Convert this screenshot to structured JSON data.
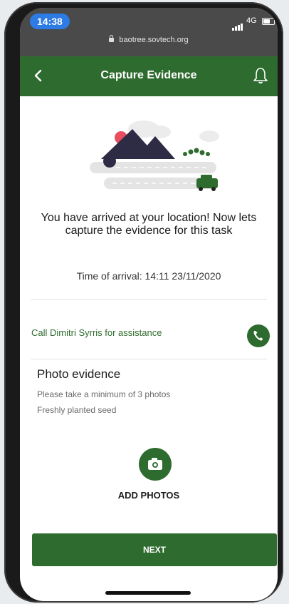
{
  "status_bar": {
    "time": "14:38",
    "network": "4G",
    "url": "baotree.sovtech.org",
    "icons": [
      "signal-icon",
      "battery-icon",
      "lock-icon"
    ]
  },
  "header": {
    "title": "Capture Evidence",
    "back_icon": "chevron-left-icon",
    "notification_icon": "bell-icon",
    "color": "#2e6b2e"
  },
  "main": {
    "illustration": "arrival-illustration",
    "headline": "You have arrived at your location! Now lets capture the evidence for this task",
    "arrival_label": "Time of arrival: 14:11 23/11/2020"
  },
  "assistance": {
    "label": "Call Dimitri Syrris for assistance",
    "icon": "phone-icon"
  },
  "photo_evidence": {
    "title": "Photo evidence",
    "instruction": "Please take a minimum of 3 photos",
    "subject": "Freshly planted seed",
    "add_label": "ADD PHOTOS",
    "icon": "camera-icon"
  },
  "footer": {
    "next_label": "NEXT"
  },
  "colors": {
    "brand_green": "#2e6b2e",
    "time_pill": "#2d7be5"
  }
}
